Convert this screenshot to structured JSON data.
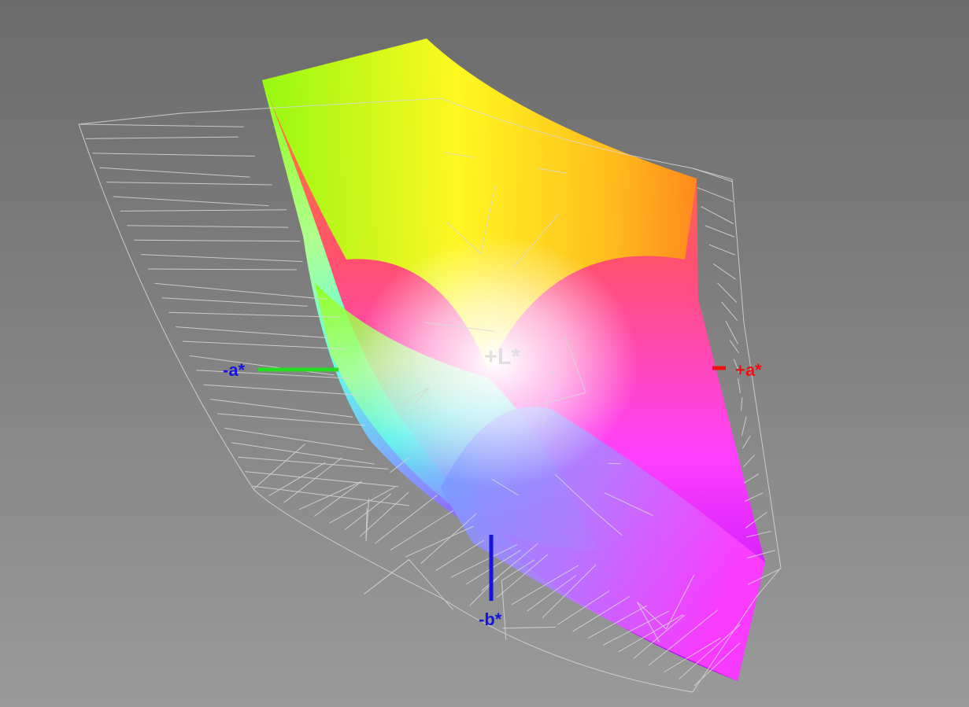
{
  "diagram": {
    "type": "lab-color-gamut-3d",
    "axes": {
      "plus_l": "+L*",
      "minus_a": "-a*",
      "plus_a": "+a*",
      "minus_b": "-b*"
    },
    "colors": {
      "background_top": "#6b6b6b",
      "background_bottom": "#9a9a9a",
      "wireframe": "#d8d8d8",
      "axis_a_negative": "#22dd22",
      "axis_a_positive": "#ee1111",
      "axis_b_negative": "#1515dd",
      "axis_l_label": "#dddddd",
      "gamut_yellow": "#ffff20",
      "gamut_green": "#90ff10",
      "gamut_orange": "#ff8c1a",
      "gamut_red": "#ff4060",
      "gamut_magenta": "#ff30ff",
      "gamut_cyan": "#50ffee",
      "gamut_blue": "#8080ff",
      "gamut_violet": "#aa00ff",
      "gamut_white": "#ffffff"
    }
  }
}
